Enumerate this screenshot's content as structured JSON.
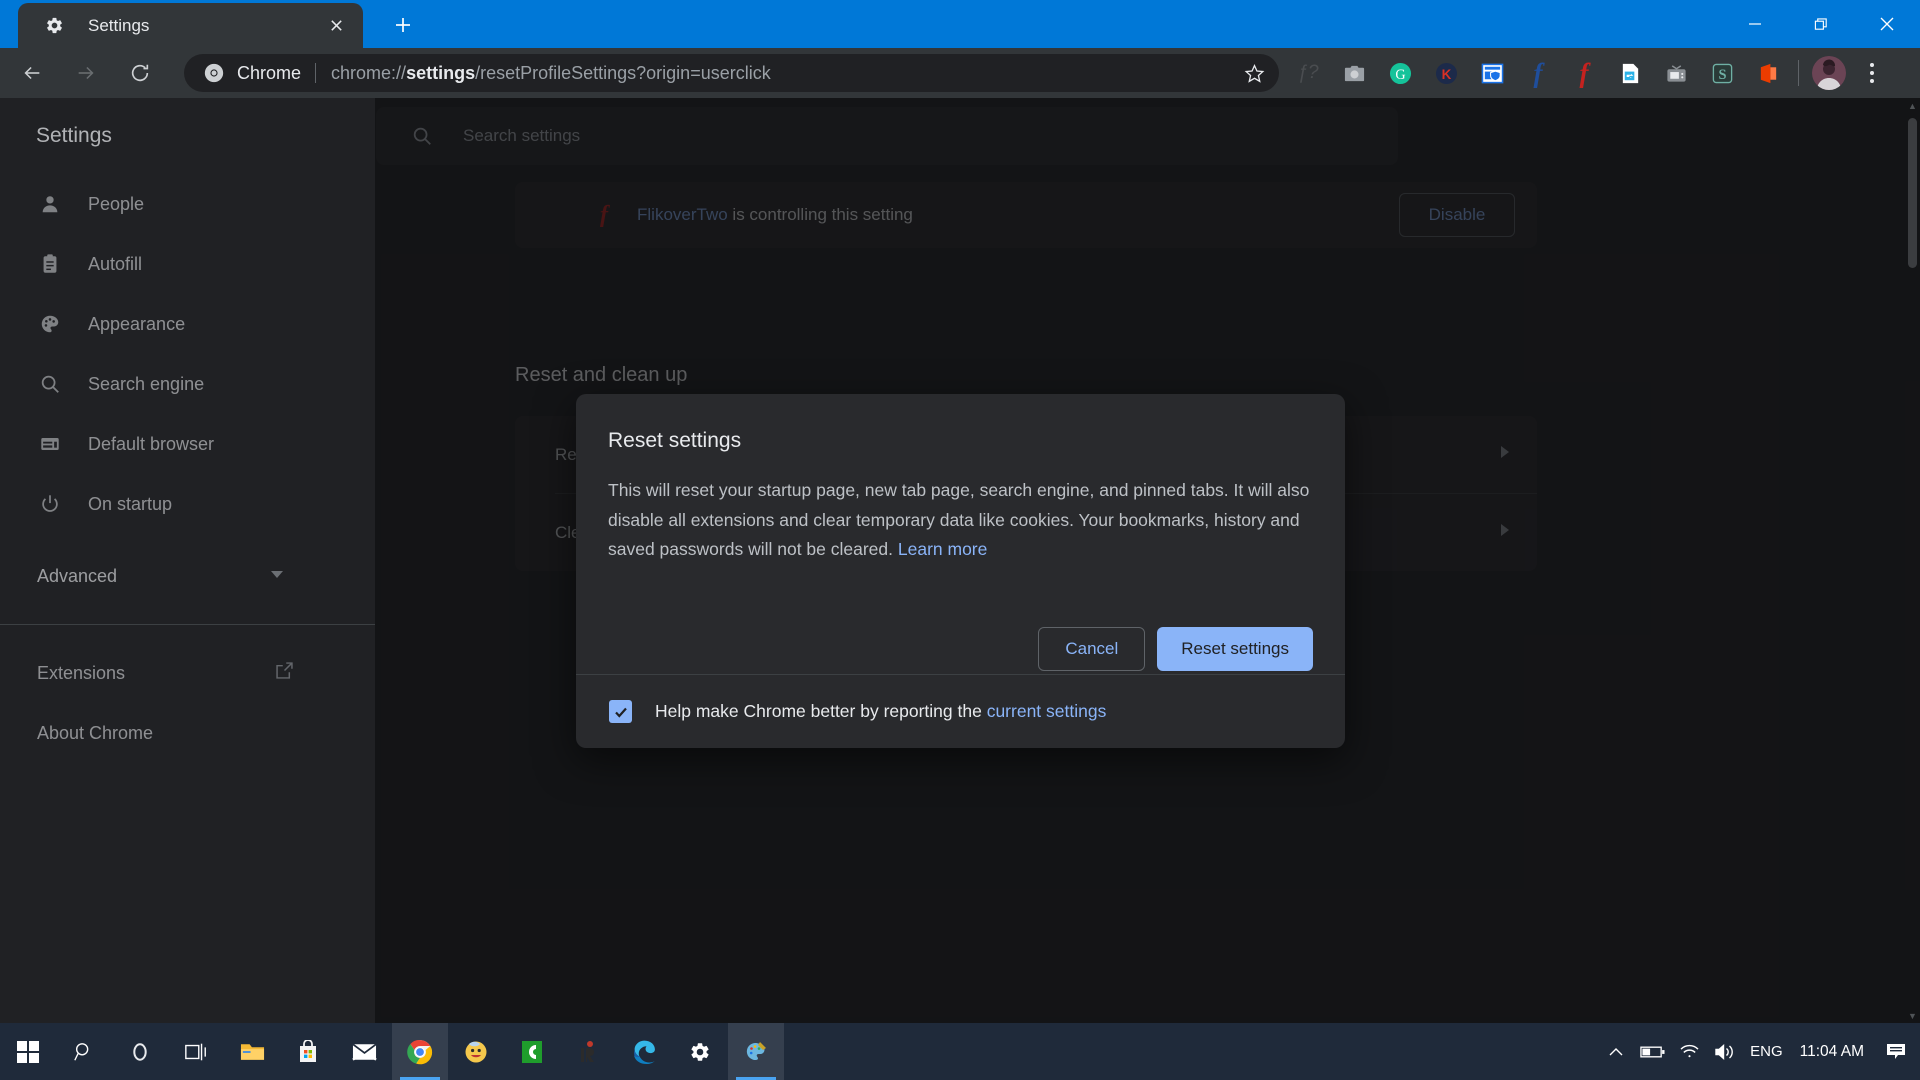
{
  "window": {
    "tab_title": "Settings",
    "tab_favicon_icon": "gear-icon",
    "close_tab_icon": "close-icon",
    "new_tab_icon": "plus-icon",
    "minimize_icon": "minimize-icon",
    "maximize_icon": "restore-icon",
    "close_icon": "close-icon"
  },
  "toolbar": {
    "back_icon": "arrow-left-icon",
    "forward_icon": "arrow-right-icon",
    "reload_icon": "reload-icon",
    "omnibox": {
      "chrome_icon": "chrome-logo-icon",
      "scheme_label": "Chrome",
      "url_prefix": "chrome://",
      "url_bold": "settings",
      "url_suffix": "/resetProfileSettings?origin=userclick",
      "bookmark_icon": "star-icon"
    },
    "extensions": [
      {
        "name": "puzzle-extension-icon",
        "glyph": "f?",
        "color": "#4a4d50"
      },
      {
        "name": "camera-extension-icon",
        "glyph": "camera",
        "color": "#9aa0a6"
      },
      {
        "name": "grammarly-extension-icon",
        "glyph": "G",
        "color": "#15c39a"
      },
      {
        "name": "kaspersky-extension-icon",
        "glyph": "K",
        "color": "#d93025"
      },
      {
        "name": "windows-defender-extension-icon",
        "glyph": "shield",
        "color": "#1a73e8"
      },
      {
        "name": "facebook-blue-extension-icon",
        "glyph": "f",
        "color": "#1f4e9c"
      },
      {
        "name": "flikover-red-extension-icon",
        "glyph": "f",
        "color": "#c5221f"
      },
      {
        "name": "download-extension-icon",
        "glyph": "download",
        "color": "#2bb3e8"
      },
      {
        "name": "video-extension-icon",
        "glyph": "tv",
        "color": "#8a8f94"
      },
      {
        "name": "sketchful-extension-icon",
        "glyph": "S",
        "color": "#3e6b63"
      },
      {
        "name": "office-extension-icon",
        "glyph": "office",
        "color": "#eb3c00"
      }
    ],
    "avatar_icon": "avatar",
    "menu_icon": "three-dots-icon"
  },
  "settings": {
    "header_title": "Settings",
    "search": {
      "icon": "search-icon",
      "placeholder": "Search settings",
      "value": ""
    },
    "sidebar": {
      "items": [
        {
          "label": "People",
          "icon": "person-icon"
        },
        {
          "label": "Autofill",
          "icon": "clipboard-icon"
        },
        {
          "label": "Appearance",
          "icon": "palette-icon"
        },
        {
          "label": "Search engine",
          "icon": "search-icon"
        },
        {
          "label": "Default browser",
          "icon": "browser-window-icon"
        },
        {
          "label": "On startup",
          "icon": "power-icon"
        }
      ],
      "advanced": {
        "label": "Advanced",
        "icon": "chevron-down-icon"
      },
      "links": [
        {
          "label": "Extensions",
          "icon": "open-in-new-icon"
        },
        {
          "label": "About Chrome",
          "icon": ""
        }
      ]
    },
    "controlled_banner": {
      "extension_icon": "flikover-red-extension-icon",
      "extension_name": "FlikoverTwo",
      "message": " is controlling this setting",
      "disable_label": "Disable"
    },
    "section_heading": "Reset and clean up",
    "rows": [
      {
        "label": "Restore settings to their original defaults",
        "arrow_icon": "chevron-right-icon"
      },
      {
        "label": "Clean up computer",
        "arrow_icon": "chevron-right-icon"
      }
    ]
  },
  "dialog": {
    "title": "Reset settings",
    "body_text": "This will reset your startup page, new tab page, search engine, and pinned tabs. It will also disable all extensions and clear temporary data like cookies. Your bookmarks, history and saved passwords will not be cleared. ",
    "learn_more_label": "Learn more",
    "cancel_label": "Cancel",
    "confirm_label": "Reset settings",
    "checkbox": {
      "checked": true,
      "check_icon": "check-icon",
      "label_prefix": "Help make Chrome better by reporting the ",
      "link_label": "current settings"
    },
    "accent_color": "#8ab4f8"
  },
  "scrollbar": {
    "up_icon": "chevron-up-icon",
    "down_icon": "chevron-down-icon"
  },
  "taskbar": {
    "items": [
      {
        "name": "start-button",
        "icon": "windows-logo-icon"
      },
      {
        "name": "search-button",
        "icon": "search-icon"
      },
      {
        "name": "cortana-button",
        "icon": "cortana-circle-icon"
      },
      {
        "name": "task-view-button",
        "icon": "task-view-icon"
      },
      {
        "name": "file-explorer-button",
        "icon": "folder-icon"
      },
      {
        "name": "microsoft-store-button",
        "icon": "store-bag-icon"
      },
      {
        "name": "mail-button",
        "icon": "mail-envelope-icon"
      },
      {
        "name": "chrome-button",
        "icon": "chrome-logo-icon",
        "active": true
      },
      {
        "name": "emoji-app-button",
        "icon": "smiley-icon"
      },
      {
        "name": "green-app-button",
        "icon": "green-c-icon"
      },
      {
        "name": "jr-app-button",
        "icon": "jr-icon"
      },
      {
        "name": "edge-button",
        "icon": "edge-logo-icon"
      },
      {
        "name": "settings-button",
        "icon": "gear-icon"
      },
      {
        "name": "paint-button",
        "icon": "paint-palette-icon",
        "active": true
      }
    ],
    "tray": {
      "overflow_icon": "chevron-up-icon",
      "battery_icon": "battery-icon",
      "network_icon": "wifi-icon",
      "volume_icon": "volume-icon",
      "language": "ENG",
      "clock": "11:04 AM",
      "action_center_icon": "notification-icon"
    }
  }
}
